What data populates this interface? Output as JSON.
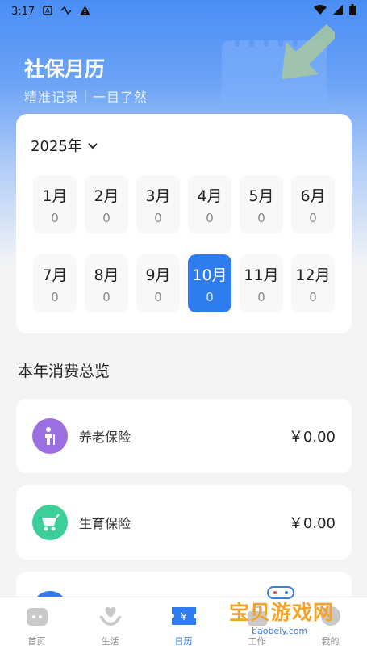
{
  "status": {
    "time": "3:17",
    "icons": [
      "A-icon",
      "nfc-icon",
      "warning-icon"
    ],
    "right_icons": [
      "wifi-icon",
      "signal-icon",
      "battery-icon"
    ]
  },
  "header": {
    "title": "社保月历",
    "subtitle": "精准记录｜一目了然"
  },
  "calendar": {
    "year_label": "2025年",
    "months": [
      {
        "label": "1月",
        "value": "0"
      },
      {
        "label": "2月",
        "value": "0"
      },
      {
        "label": "3月",
        "value": "0"
      },
      {
        "label": "4月",
        "value": "0"
      },
      {
        "label": "5月",
        "value": "0"
      },
      {
        "label": "6月",
        "value": "0"
      },
      {
        "label": "7月",
        "value": "0"
      },
      {
        "label": "8月",
        "value": "0"
      },
      {
        "label": "9月",
        "value": "0"
      },
      {
        "label": "10月",
        "value": "0"
      },
      {
        "label": "11月",
        "value": "0"
      },
      {
        "label": "12月",
        "value": "0"
      }
    ],
    "active_month_index": 9
  },
  "overview": {
    "title": "本年消费总览",
    "items": [
      {
        "name": "养老保险",
        "amount": "￥0.00",
        "color": "#9b6fe0",
        "icon": "elderly-icon"
      },
      {
        "name": "生育保险",
        "amount": "￥0.00",
        "color": "#3dcf9a",
        "icon": "baby-stroller-icon"
      },
      {
        "name": "",
        "amount": "",
        "color": "#2f7bf0",
        "icon": "insurance-icon"
      }
    ]
  },
  "tabbar": {
    "tabs": [
      {
        "label": "首页",
        "icon": "home-icon"
      },
      {
        "label": "生活",
        "icon": "heart-hand-icon"
      },
      {
        "label": "日历",
        "icon": "calendar-ticket-icon"
      },
      {
        "label": "工作",
        "icon": "work-icon"
      },
      {
        "label": "我的",
        "icon": "profile-icon"
      }
    ],
    "active_index": 2
  },
  "watermark": {
    "text": "宝贝游戏网",
    "url": "baobeiy.com"
  },
  "colors": {
    "accent": "#2f7bf0",
    "hero": "#4a8ef5"
  }
}
